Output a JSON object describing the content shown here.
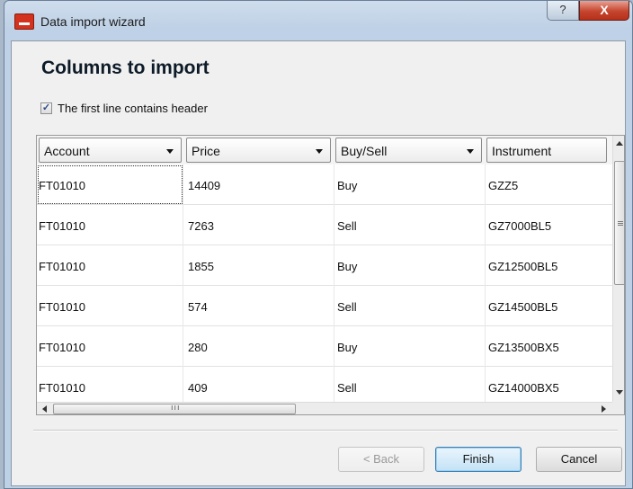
{
  "window": {
    "title": "Data import wizard",
    "help_glyph": "?",
    "close_glyph": "X"
  },
  "page": {
    "title": "Columns to import",
    "header_checkbox": {
      "label": "The first line contains header",
      "checked": true,
      "check_glyph": "✓"
    }
  },
  "grid": {
    "columns": [
      {
        "label": "Account"
      },
      {
        "label": "Price"
      },
      {
        "label": "Buy/Sell"
      },
      {
        "label": "Instrument"
      }
    ],
    "rows": [
      [
        "FT01010",
        "14409",
        "Buy",
        "GZZ5"
      ],
      [
        "FT01010",
        "7263",
        "Sell",
        "GZ7000BL5"
      ],
      [
        "FT01010",
        "1855",
        "Buy",
        "GZ12500BL5"
      ],
      [
        "FT01010",
        "574",
        "Sell",
        "GZ14500BL5"
      ],
      [
        "FT01010",
        "280",
        "Buy",
        "GZ13500BX5"
      ],
      [
        "FT01010",
        "409",
        "Sell",
        "GZ14000BX5"
      ]
    ]
  },
  "buttons": {
    "back": "< Back",
    "finish": "Finish",
    "cancel": "Cancel"
  }
}
